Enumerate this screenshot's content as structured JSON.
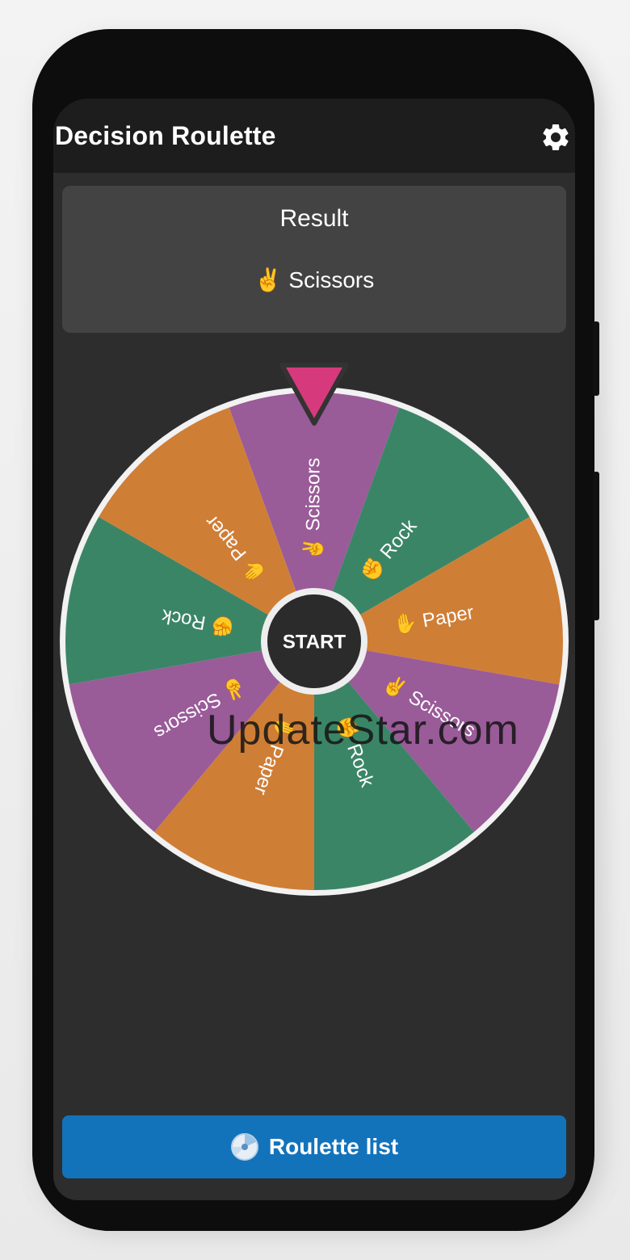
{
  "app": {
    "title": "Decision Roulette"
  },
  "header": {
    "settings_icon": "gear-icon"
  },
  "result": {
    "title": "Result",
    "emoji": "✌️",
    "label": "Scissors"
  },
  "wheel": {
    "start_label": "START",
    "pointer_color": "#d63a7c",
    "segments": [
      {
        "label": "Scissors",
        "emoji": "✌️",
        "color": "#9a5b99"
      },
      {
        "label": "Rock",
        "emoji": "✊",
        "color": "#3b8567"
      },
      {
        "label": "Paper",
        "emoji": "✋",
        "color": "#cf7e36"
      },
      {
        "label": "Scissors",
        "emoji": "✌️",
        "color": "#9a5b99"
      },
      {
        "label": "Rock",
        "emoji": "✊",
        "color": "#3b8567"
      },
      {
        "label": "Paper",
        "emoji": "✋",
        "color": "#cf7e36"
      },
      {
        "label": "Scissors",
        "emoji": "✌️",
        "color": "#9a5b99"
      },
      {
        "label": "Rock",
        "emoji": "✊",
        "color": "#3b8567"
      },
      {
        "label": "Paper",
        "emoji": "✋",
        "color": "#cf7e36"
      }
    ]
  },
  "footer": {
    "list_button_label": "Roulette list",
    "list_button_icon": "roulette-disc-icon"
  },
  "watermark": "UpdateStar.com",
  "colors": {
    "accent": "#1273bb",
    "appbar": "#1d1d1d",
    "background": "#2d2d2d",
    "card": "#434343"
  }
}
